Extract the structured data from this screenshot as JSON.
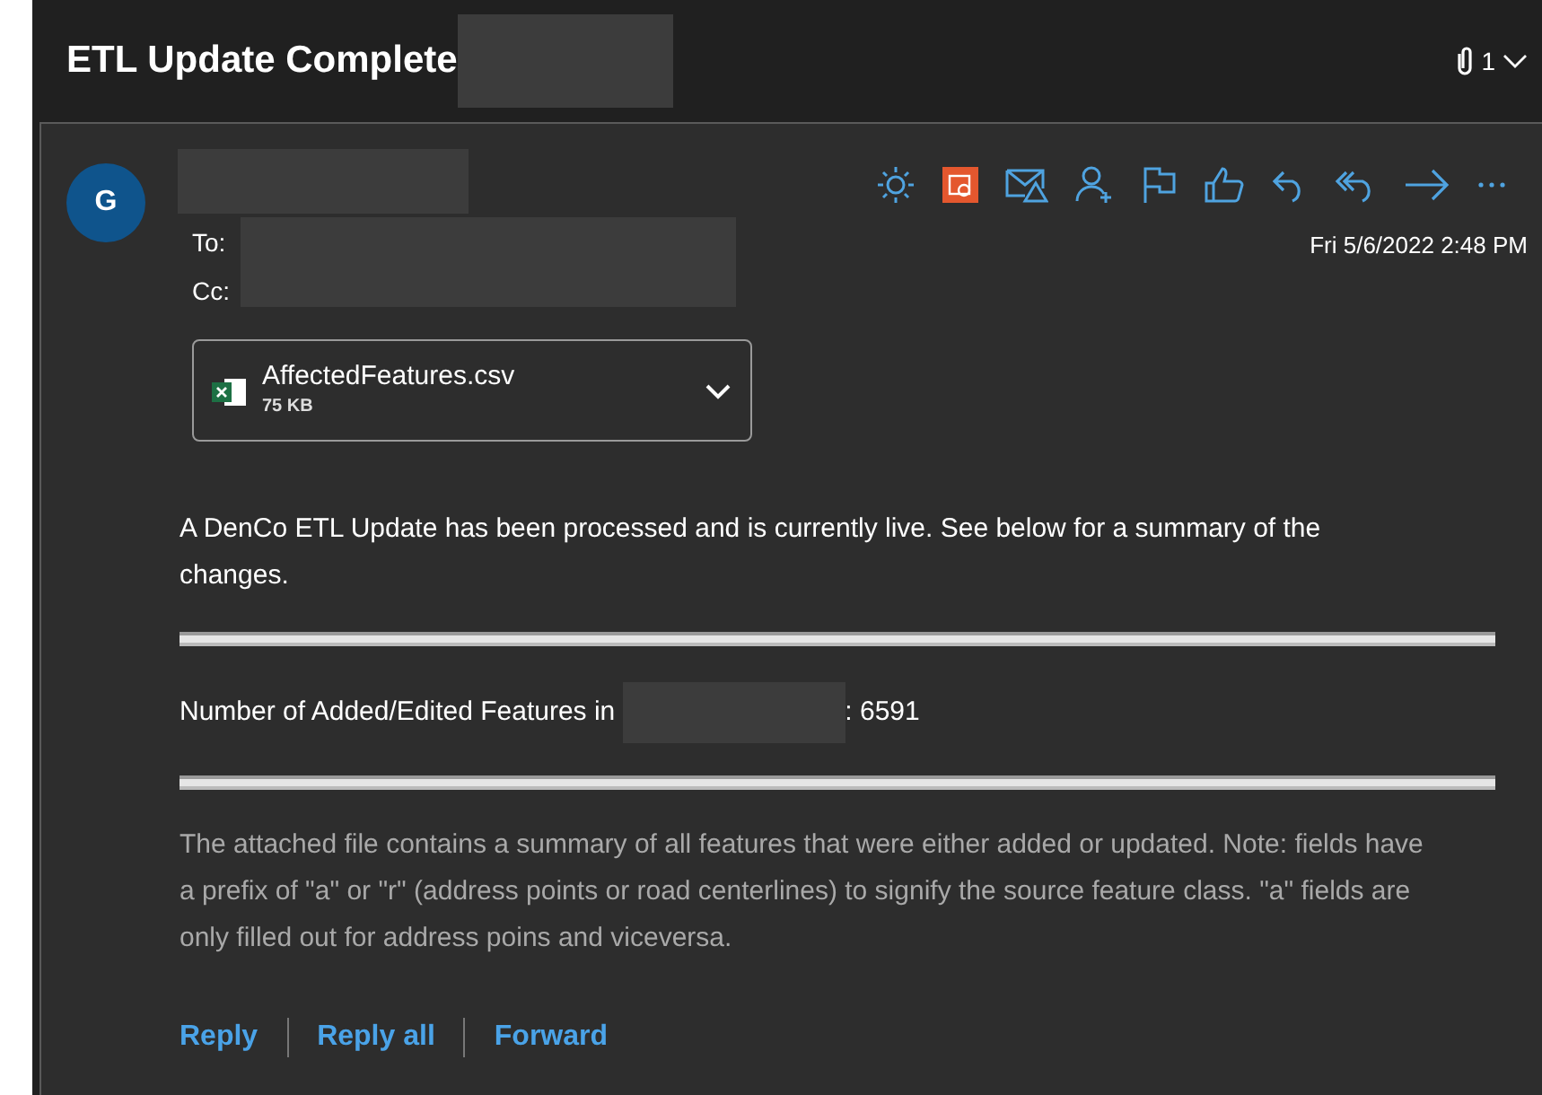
{
  "header": {
    "title": "ETL Update Complete",
    "attachment_count": "1"
  },
  "message": {
    "avatar_initial": "G",
    "to_label": "To:",
    "cc_label": "Cc:",
    "date": "Fri 5/6/2022 2:48 PM"
  },
  "attachment": {
    "name": "AffectedFeatures.csv",
    "size": "75 KB"
  },
  "body": {
    "intro": "A DenCo ETL Update has been processed and is currently live. See below for a summary of the changes.",
    "summary_label": "Number of Added/Edited Features in",
    "summary_value": ": 6591",
    "note": "The attached file contains a summary of all features that were either added or updated. Note: fields have a prefix of \"a\" or \"r\" (address points or road centerlines) to signify the source feature class. \"a\" fields are only filled out for address poins and viceversa."
  },
  "footer_links": [
    "Reply",
    "Reply all",
    "Forward"
  ]
}
